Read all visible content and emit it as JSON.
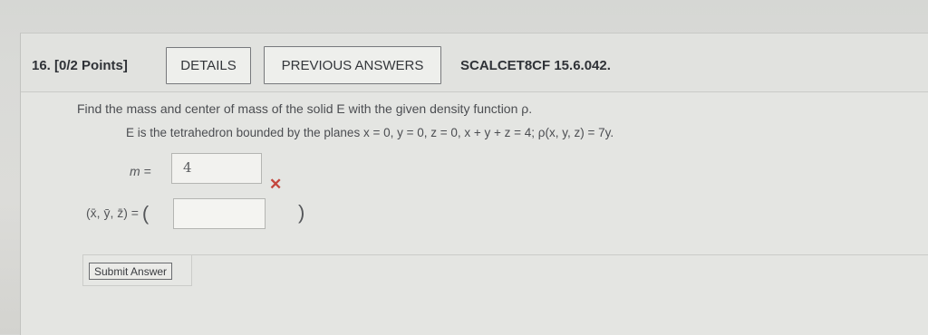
{
  "question": {
    "number_label": "16.  [0/2 Points]",
    "details_label": "DETAILS",
    "previous_answers_label": "PREVIOUS ANSWERS",
    "problem_code": "SCALCET8CF 15.6.042."
  },
  "prompt": {
    "line1": "Find the mass and center of mass of the solid E with the given density function ρ.",
    "line2": "E is the tetrahedron bounded by the planes  x = 0,   y = 0,   z = 0,   x + y + z = 4;    ρ(x, y, z) = 7y."
  },
  "answers": {
    "mass_label": "m =",
    "mass_value": "4",
    "mass_status": "incorrect",
    "mass_status_icon": "red-x-icon",
    "center_label": "(x̄, ȳ, z̄)",
    "center_equals": "=",
    "center_open_paren": "(",
    "center_close_paren": ")",
    "center_value": ""
  },
  "submit": {
    "label": "Submit Answer"
  },
  "colors": {
    "incorrect": "#c4473e"
  }
}
